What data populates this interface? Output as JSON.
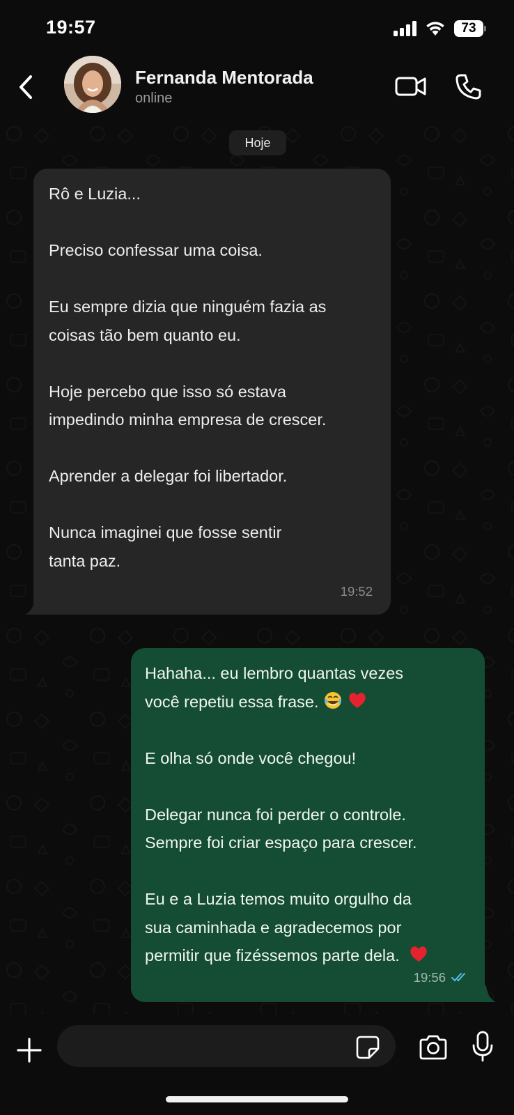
{
  "status_bar": {
    "time": "19:57",
    "battery": "73"
  },
  "header": {
    "contact_name": "Fernanda Mentorada",
    "contact_status": "online",
    "icons": [
      "back-chevron-icon",
      "video-camera-icon",
      "phone-icon"
    ]
  },
  "conversation": {
    "date_label": "Hoje",
    "messages": [
      {
        "direction": "incoming",
        "text": "Rô e Luzia...\n\nPreciso confessar uma coisa.\n\nEu sempre dizia que ninguém fazia as\ncoisas tão bem quanto eu.\n\nHoje percebo que isso só estava\nimpedindo minha empresa de crescer.\n\nAprender a delegar foi libertador.\n\nNunca imaginei que fosse sentir\ntanta paz.",
        "time": "19:52"
      },
      {
        "direction": "outgoing",
        "text_line1": "Hahaha... eu lembro quantas vezes",
        "text_line2": "você repetiu essa frase.",
        "text_rest": "E olha só onde você chegou!\n\nDelegar nunca foi perder o controle.\nSempre foi criar espaço para crescer.\n\nEu e a Luzia temos muito orgulho da\nsua caminhada e agradecemos por\npermitir que fizéssemos parte dela.",
        "time": "19:56",
        "status": "read"
      }
    ]
  },
  "input": {
    "placeholder": ""
  },
  "colors": {
    "background": "#0c0c0c",
    "incoming_bubble": "#262626",
    "outgoing_bubble": "#144d33",
    "read_tick": "#53bdeb"
  }
}
